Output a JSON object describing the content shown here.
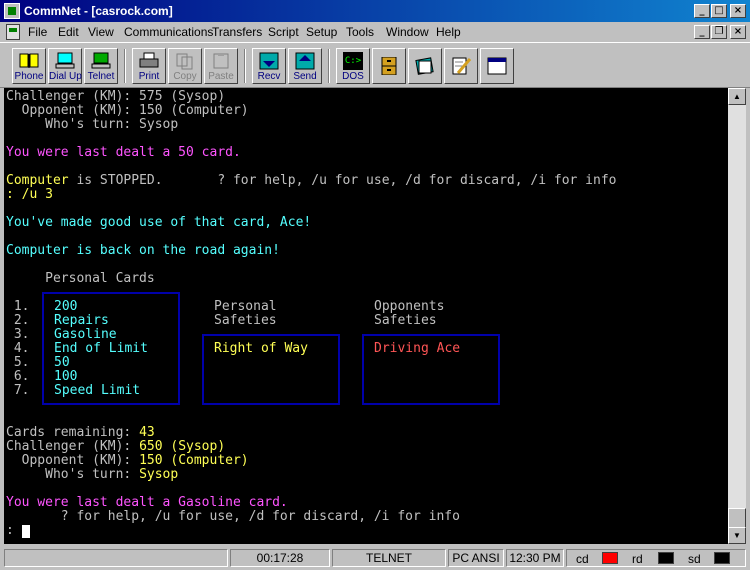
{
  "window": {
    "title": "CommNet - [casrock.com]"
  },
  "menu": [
    "File",
    "Edit",
    "View",
    "Communications",
    "Transfers",
    "Script",
    "Setup",
    "Tools",
    "Window",
    "Help"
  ],
  "toolbar": {
    "phone": "Phone",
    "dialup": "Dial Up",
    "telnet": "Telnet",
    "print": "Print",
    "copy": "Copy",
    "paste": "Paste",
    "recv": "Recv",
    "send": "Send",
    "dos": "DOS",
    "dos_icon_text": "C:>"
  },
  "terminal": {
    "top_challenger": "Challenger (KM): 575 (Sysop)",
    "top_opponent": "  Opponent (KM): 150 (Computer)",
    "top_turn": "     Who's turn: Sysop",
    "dealt_1": "You were last dealt a 50 card.",
    "computer_label": "Computer",
    "stopped_text": " is STOPPED.       ? for help, /u for use, /d for discard, /i for info",
    "cmd_input": ": /u 3",
    "good_use": "You've made good use of that card, Ace!",
    "back_on_road": "Computer is back on the road again!",
    "personal_cards_heading": "     Personal Cards",
    "card_numbers": [
      " 1.",
      " 2.",
      " 3.",
      " 4.",
      " 5.",
      " 6.",
      " 7."
    ],
    "cards": [
      "200",
      "Repairs",
      "Gasoline",
      "End of Limit",
      "50",
      "100",
      "Speed Limit"
    ],
    "personal_safeties_heading_1": "Personal",
    "personal_safeties_heading_2": "Safeties",
    "personal_safeties": [
      "Right of Way"
    ],
    "opponents_safeties_heading_1": "Opponents",
    "opponents_safeties_heading_2": "Safeties",
    "opponents_safeties": [
      "Driving Ace"
    ],
    "cards_remaining_label": "Cards remaining: ",
    "cards_remaining_value": "43",
    "challenger_label": "Challenger (KM): ",
    "challenger_value": "650 (Sysop)",
    "opponent_label": "  Opponent (KM): ",
    "opponent_value": "150 (Computer)",
    "turn_label": "     Who's turn: ",
    "turn_value": "Sysop",
    "dealt_2": "You were last dealt a Gasoline card.",
    "help_line": "       ? for help, /u for use, /d for discard, /i for info",
    "prompt": ": "
  },
  "status": {
    "timer": "00:17:28",
    "protocol": "TELNET",
    "emulation": "PC ANSI",
    "clock": "12:30 PM",
    "cd_label": "cd",
    "rd_label": "rd",
    "sd_label": "sd",
    "cd_color": "#ff0000",
    "rd_color": "#000000",
    "sd_color": "#000000"
  }
}
